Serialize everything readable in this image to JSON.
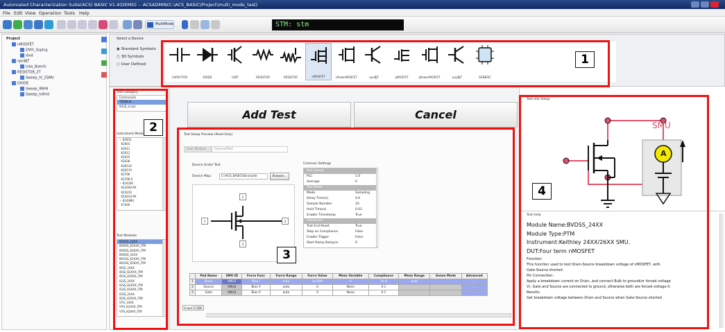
{
  "window": {
    "title": "Automated Characterization Suite(ACS) BASIC V1.4(DEMO) -- ACSADMIN(C:\\ACS_BASIC\\Project\\multi_mode_test)"
  },
  "menu": [
    "File",
    "Edit",
    "View",
    "Operation",
    "Tools",
    "Help"
  ],
  "toolbar": {
    "multimode_label": "MultiMode",
    "stm_label": "STM: stm"
  },
  "project_tree": {
    "root": "Project",
    "items": [
      "nMOSFET",
      "DVth_Ssping",
      "idvd",
      "npnBJT",
      "Icbo_Bsenfs",
      "RESISTOR_2T",
      "Sweep_IV_2SMU",
      "DIODE",
      "Sweep_IRVHI",
      "Sweep_IvIHrd"
    ]
  },
  "device_select": {
    "heading": "Select a Device",
    "options": [
      "Standard Symbols",
      "3D Symbols",
      "User Defined"
    ],
    "selected": "Standard Symbols",
    "devices": [
      "CAPACITOR",
      "DIODE",
      "IGBT",
      "RESISTOR",
      "RESISTOR",
      "nMOSFET",
      "nPowerMOSFET",
      "npnBJT",
      "pMOSFET",
      "pPowerMOSFET",
      "pnpBJT",
      "GENERIC"
    ],
    "active_device": "nMOSFET"
  },
  "test_category": {
    "heading": "Test Category",
    "items": [
      "CommonLib",
      "TDDBLib",
      "KULE_script"
    ],
    "selected": "TDDBLib"
  },
  "instrument_module": {
    "heading": "Instrument Modules",
    "items": [
      "K2601",
      "K2602",
      "K2611",
      "K2612",
      "K2635",
      "K2636",
      "K2651A",
      "K2657A",
      "K2706",
      "K2706-S",
      "K24200",
      "K24200-PA",
      "K24210",
      "K24210-PA",
      "K24SMU",
      "K7400"
    ]
  },
  "test_modules": {
    "heading": "Test Modules",
    "items": [
      "BVDSS_24XX",
      "BVDSS_K2XXX_ITM",
      "BVDSS_K26XX_ITM",
      "BVDSS_24XX",
      "BVGSS_K2XXX_ITM",
      "BVGSS_K26XX_ITM",
      "IDSS_24XX",
      "IDSS_K2XXX_ITM",
      "IDSS_K26XX_ITM",
      "IGSS_24XX",
      "IGSS_K2XXX_ITM",
      "IGSS_K26XX_ITM",
      "IGSS_24XX",
      "IDSS_K26XX_ITM",
      "VTH_24XX",
      "VTH_K2XXX_ITM",
      "VTH_K26XX_ITM"
    ],
    "selected": "BVDSS_24XX"
  },
  "actions": {
    "add_test": "Add Test",
    "cancel": "Cancel"
  },
  "setup_preview": {
    "heading": "Test Setup Preview (Read Only)",
    "tab_user_module": "User Module",
    "tab_general": "GeneralTest",
    "dut_heading": "Device Under Test",
    "device_map_label": "Device Map:",
    "device_map_path": "C:\\ACS_BASIC\\library\\de",
    "browse_label": "Browse...",
    "pins": [
      "2",
      "1",
      "4",
      "3"
    ],
    "common_settings_heading": "Common Settings",
    "settings": [
      {
        "group": "Test Speed"
      },
      {
        "name": "PLC",
        "value": "1.0"
      },
      {
        "name": "Average",
        "value": "0"
      },
      {
        "group": "Test Mode"
      },
      {
        "name": "Mode",
        "value": "Sampling"
      },
      {
        "name": "Delay Time(s)",
        "value": "0.0"
      },
      {
        "name": "Sample Number",
        "value": "10"
      },
      {
        "name": "Hold Time(s)",
        "value": "0.01"
      },
      {
        "name": "Enable Timestamp",
        "value": "True"
      },
      {
        "group": "Advanced"
      },
      {
        "name": "Test End Reset",
        "value": "True"
      },
      {
        "name": "Stop on Compliance",
        "value": "False"
      },
      {
        "name": "Enable Trigger",
        "value": "False"
      },
      {
        "name": "Start Ramp Delay(s)",
        "value": "0"
      }
    ],
    "table_headers": [
      "",
      "Pad Name",
      "SMU ID",
      "Force Func",
      "Force Range",
      "Force Value",
      "Meas Variable",
      "Compliance",
      "Meas Range",
      "Sense Mode",
      "Advanced"
    ],
    "table_rows": [
      [
        "1",
        "Drain",
        "SMU1",
        "Bias I",
        "auto",
        "1e-009",
        "V",
        "1e-4",
        "auto",
        "",
        "..."
      ],
      [
        "2",
        "Source",
        "SMU2",
        "Bias V",
        "auto",
        "0",
        "None",
        "0.1",
        "",
        "",
        "..."
      ],
      [
        "3",
        "Gate",
        "SMU3",
        "Bias V",
        "auto",
        "0",
        "None",
        "0.1",
        "",
        "",
        "..."
      ]
    ],
    "bottom_tabs": [
      "Graph",
      "GUI"
    ]
  },
  "test_info": {
    "heading": "Test Info Setup",
    "smu_label": "SMU",
    "ammeter_label": "A",
    "help_heading": "Test Help",
    "module_name": "Module Name:BVDSS_24XX",
    "module_type": "Module Type:PTM",
    "instrument": "Instrument:Keithley 24XX/26XX SMU.",
    "dut": "DUT:Four term nMOSFET",
    "function_label": "Function:",
    "function_text_1": "This function used to test Drain-Source breakdown voltage of nMOSFET, with",
    "function_text_2": "Gate-Source shorted.",
    "pin_label": "Pin Connection:",
    "pin_text_1": "Apply a  breakdown current on Drain, and connect Bulk to ground(or forced voltage",
    "pin_text_2": "V). Gate and Source are connected to ground, otherwise both are forced voltage 0.",
    "results_label": "Results:",
    "results_text": "Get breakdown voltage between Drain and Source when Gate-Source shorted"
  },
  "callouts": [
    "1",
    "2",
    "3",
    "4"
  ]
}
